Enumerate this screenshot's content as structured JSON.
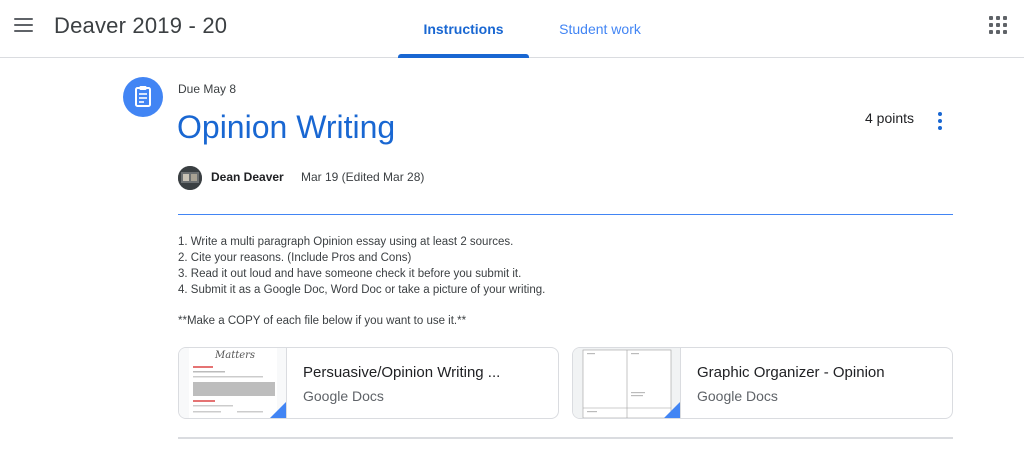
{
  "header": {
    "class_title": "Deaver 2019 - 20",
    "tabs": [
      {
        "label": "Instructions",
        "active": true
      },
      {
        "label": "Student work",
        "active": false
      }
    ]
  },
  "assignment": {
    "due": "Due May 8",
    "title": "Opinion Writing",
    "points": "4 points",
    "author": "Dean Deaver",
    "posted": "Mar 19 (Edited Mar 28)",
    "instructions": [
      "1. Write a multi paragraph Opinion essay using at least 2 sources.",
      "2. Cite your reasons. (Include Pros and Cons)",
      "3. Read it out loud and have someone check it before you submit it.",
      "4. Submit it as a Google Doc, Word Doc or take a picture of your writing."
    ],
    "note": "**Make a COPY of each file below if you want to use it.**"
  },
  "attachments": [
    {
      "title": "Persuasive/Opinion Writing ...",
      "type": "Google Docs",
      "thumb_text": "Matters"
    },
    {
      "title": "Graphic Organizer - Opinion",
      "type": "Google Docs"
    }
  ],
  "colors": {
    "accent": "#1967d2",
    "accent_light": "#4285f4",
    "divider": "#dadce0"
  },
  "icons": {
    "menu": "hamburger-menu-icon",
    "apps": "apps-grid-icon",
    "assignment": "assignment-clipboard-icon",
    "more": "more-vert-icon",
    "doc": "google-docs-corner-icon"
  }
}
